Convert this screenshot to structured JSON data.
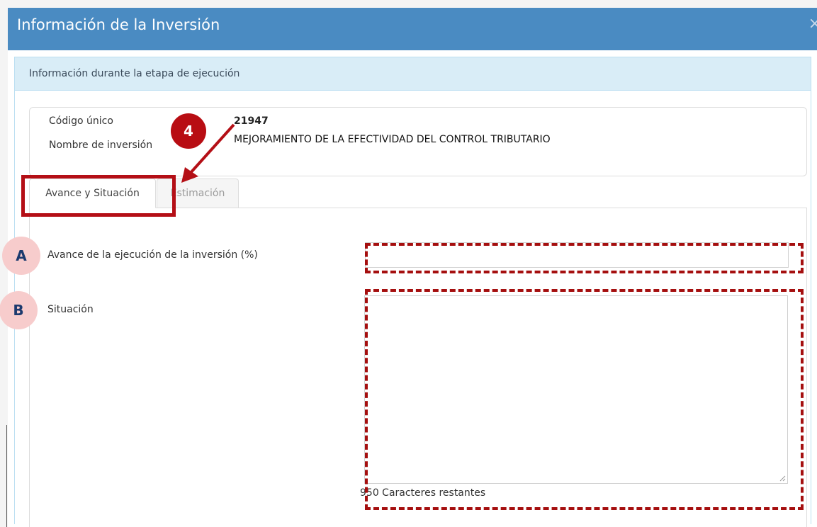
{
  "modal": {
    "title": "Información de la Inversión",
    "close_glyph": "×"
  },
  "panel": {
    "heading": "Información durante la etapa de ejecución"
  },
  "info": {
    "codigo_label": "Código único",
    "codigo_value": "21947",
    "nombre_label": "Nombre de inversión",
    "nombre_value": "MEJORAMIENTO DE LA EFECTIVIDAD DEL CONTROL TRIBUTARIO"
  },
  "tabs": [
    {
      "label": "Avance y Situación",
      "active": true
    },
    {
      "label": "Estimación",
      "active": false
    }
  ],
  "form": {
    "avance_label": "Avance de la ejecución de la inversión (%)",
    "avance_value": "",
    "situacion_label": "Situación",
    "situacion_value": "",
    "chars_remaining": "950 Caracteres restantes"
  },
  "annotations": {
    "step": "4",
    "marker_a": "A",
    "marker_b": "B",
    "color": "#b40f16",
    "marker_bg": "#f7cccc"
  },
  "colors": {
    "header": "#4a8bc2",
    "panel_heading": "#d9edf7"
  }
}
